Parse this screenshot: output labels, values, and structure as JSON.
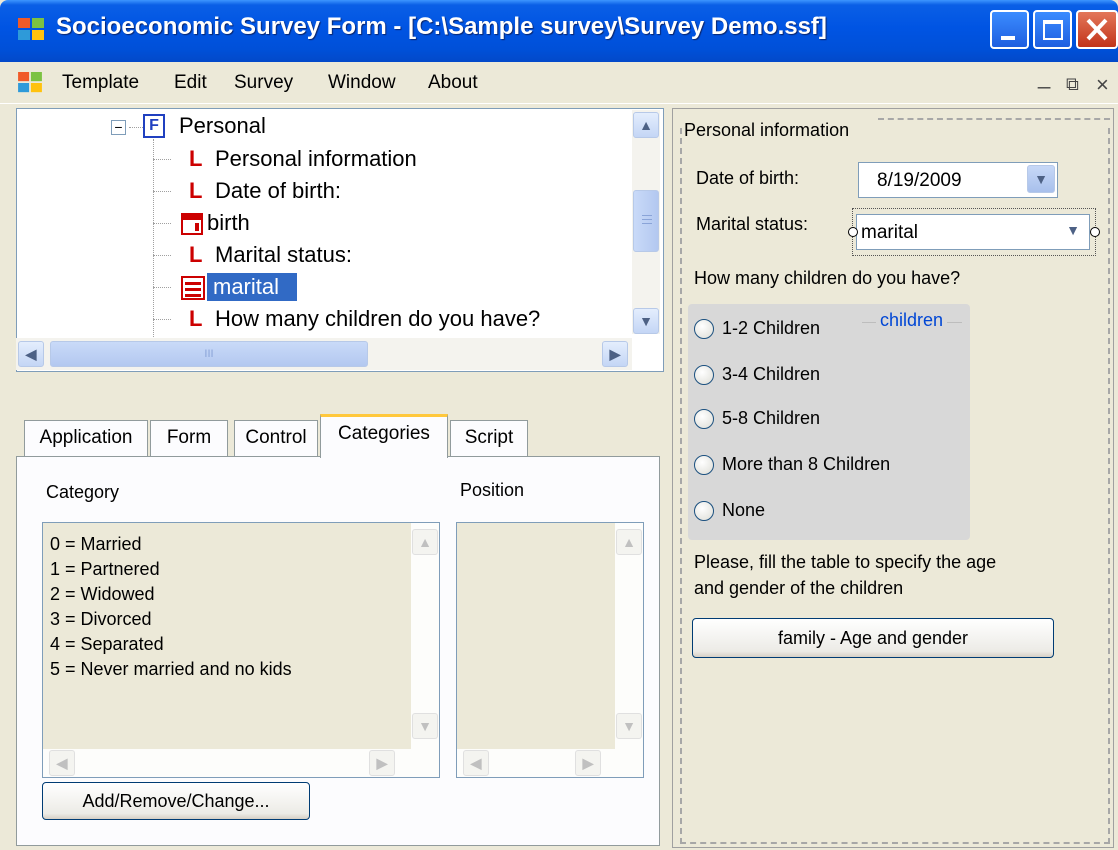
{
  "window": {
    "title": "Socioeconomic Survey Form - [C:\\Sample survey\\Survey Demo.ssf]",
    "caption_minimize": "_",
    "caption_maximize": "□",
    "caption_close": "X"
  },
  "menu": {
    "items": [
      "Template",
      "Edit",
      "Survey",
      "Window",
      "About"
    ],
    "mdi_minimize": "_",
    "mdi_restore": "⧉",
    "mdi_close": "×"
  },
  "tree": {
    "root": {
      "expander": "−",
      "type_badge": "F",
      "label": "Personal"
    },
    "nodes": [
      {
        "icon": "label-icon",
        "glyph": "L",
        "label": "Personal information"
      },
      {
        "icon": "label-icon",
        "glyph": "L",
        "label": "Date of birth:"
      },
      {
        "icon": "date-control-icon",
        "label": "birth"
      },
      {
        "icon": "label-icon",
        "glyph": "L",
        "label": "Marital status:"
      },
      {
        "icon": "combo-control-icon",
        "label": "marital",
        "selected": true
      },
      {
        "icon": "label-icon",
        "glyph": "L",
        "label": "How many children do you have?"
      }
    ],
    "hscroll_grip": "III"
  },
  "tabs": {
    "items": [
      "Application",
      "Form",
      "Control",
      "Categories",
      "Script"
    ],
    "active": "Categories"
  },
  "categories": {
    "category_header": "Category",
    "position_header": "Position",
    "items": [
      "0 = Married",
      "1 = Partnered",
      "2 = Widowed",
      "3 = Divorced",
      "4 = Separated",
      "5 = Never married and no kids"
    ],
    "button_label": "Add/Remove/Change..."
  },
  "form": {
    "group_title": "Personal information",
    "dob_label": "Date of birth:",
    "dob_value": "8/19/2009",
    "marital_label": "Marital status:",
    "marital_value": "marital",
    "children_question": "How many children do you have?",
    "radio_group_caption": "children",
    "radio_options": [
      "1-2 Children",
      "3-4 Children",
      "5-8 Children",
      "More than 8 Children",
      "None"
    ],
    "table_instruction_line1": "Please, fill the table to specify the age",
    "table_instruction_line2": "and gender of the children",
    "table_button_label": "family - Age and gender"
  },
  "colors": {
    "titlebar_blue": "#0054E3",
    "selection_blue": "#316AC5",
    "label_red": "#CC0000",
    "active_tab_accent": "#FFC83C",
    "radio_caption_blue": "#0046D5"
  }
}
